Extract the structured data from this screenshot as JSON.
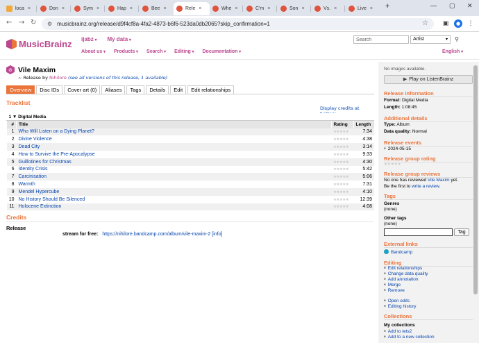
{
  "browser": {
    "tabs": [
      {
        "label": "loca",
        "icon": "note-favicon"
      },
      {
        "label": "Don",
        "icon": "mb-favicon"
      },
      {
        "label": "Sym",
        "icon": "mb-favicon"
      },
      {
        "label": "Hap",
        "icon": "mb-favicon"
      },
      {
        "label": "Bee",
        "icon": "mb-favicon"
      },
      {
        "label": "Rele",
        "icon": "mb-favicon",
        "active": true
      },
      {
        "label": "Whe",
        "icon": "mb-favicon"
      },
      {
        "label": "C'm",
        "icon": "mb-favicon"
      },
      {
        "label": "Son",
        "icon": "mb-favicon"
      },
      {
        "label": "Vs. ",
        "icon": "mb-favicon"
      },
      {
        "label": "Live",
        "icon": "mb-favicon"
      }
    ],
    "tab_close": "×",
    "new_tab": "+",
    "url": "musicbrainz.org/release/d9f4cf8a-4fa2-4873-b6f6-523da0db2065?skip_confirmation=1",
    "profile_initial": "ⓘ"
  },
  "header": {
    "logo_text": "MusicBrainz",
    "user_menu": [
      "ijabz",
      "My data"
    ],
    "nav": [
      "About us",
      "Products",
      "Search",
      "Editing",
      "Documentation"
    ],
    "language": "English",
    "search_placeholder": "Search",
    "search_type": "Artist"
  },
  "release": {
    "title": "Vile Maxim",
    "by_prefix": "~ Release by ",
    "artist": "Nihilore",
    "all_versions": "(see all versions of this release, 1 available)"
  },
  "tabs": [
    "Overview",
    "Disc IDs",
    "Cover art (0)",
    "Aliases",
    "Tags",
    "Details",
    "Edit",
    "Edit relationships"
  ],
  "tracklist": {
    "heading": "Tracklist",
    "display_credits": "Display credits at bottom",
    "medium": "1 ▼ Digital Media",
    "col_num": "#",
    "col_title": "Title",
    "col_rating": "Rating",
    "col_length": "Length",
    "tracks": [
      {
        "n": "1",
        "title": "Who Will Listen on a Dying Planet?",
        "length": "7:34"
      },
      {
        "n": "2",
        "title": "Divine Violence",
        "length": "4:38"
      },
      {
        "n": "3",
        "title": "Dead City",
        "length": "3:14"
      },
      {
        "n": "4",
        "title": "How to Survive the Pre-Apocalypse",
        "length": "9:33"
      },
      {
        "n": "5",
        "title": "Guillotines for Christmas",
        "length": "4:30"
      },
      {
        "n": "6",
        "title": "Identity Crisis",
        "length": "5:42"
      },
      {
        "n": "7",
        "title": "Carcinisation",
        "length": "5:06"
      },
      {
        "n": "8",
        "title": "Warmth",
        "length": "7:31"
      },
      {
        "n": "9",
        "title": "Mendel Hypercube",
        "length": "4:10"
      },
      {
        "n": "10",
        "title": "No History Should Be Silenced",
        "length": "12:39"
      },
      {
        "n": "11",
        "title": "Holocene Extinction",
        "length": "4:08"
      }
    ]
  },
  "credits": {
    "heading": "Credits",
    "release_label": "Release",
    "stream_label": "stream for free:",
    "stream_url": "https://nihilore.bandcamp.com/album/vile-maxim-2",
    "info": "[info]"
  },
  "sidebar": {
    "no_images": "No images available.",
    "listenbrainz": "Play on ListenBrainz",
    "release_info_h": "Release information",
    "format_label": "Format:",
    "format_value": "Digital Media",
    "length_label": "Length:",
    "length_value": "1:08:45",
    "additional_h": "Additional details",
    "type_label": "Type:",
    "type_value": "Album",
    "dq_label": "Data quality:",
    "dq_value": "Normal",
    "events_h": "Release events",
    "event_date": "2024-05-15",
    "rg_rating_h": "Release group rating",
    "rg_reviews_h": "Release group reviews",
    "review_text": "No one has reviewed ",
    "review_link": "Vile Maxim",
    "review_text2": " yet.",
    "review_first": "Be the first to ",
    "review_write": "write a review",
    "review_end": ".",
    "tags_h": "Tags",
    "genres_label": "Genres",
    "genres_value": "(none)",
    "other_tags_label": "Other tags",
    "other_tags_value": "(none)",
    "tag_button": "Tag",
    "external_h": "External links",
    "bandcamp": "Bandcamp",
    "editing_h": "Editing",
    "editing_links": [
      "Edit relationships",
      "Change data quality",
      "Add annotation",
      "Merge",
      "Remove"
    ],
    "edit_links2": [
      "Open edits",
      "Editing history"
    ],
    "collections_h": "Collections",
    "my_collections": "My collections",
    "collection_links": [
      "Add to tets2",
      "Add to a new collection"
    ]
  },
  "colors": {
    "brand_purple": "#ba478f",
    "brand_orange": "#eb743b",
    "link": "#0645ad"
  }
}
